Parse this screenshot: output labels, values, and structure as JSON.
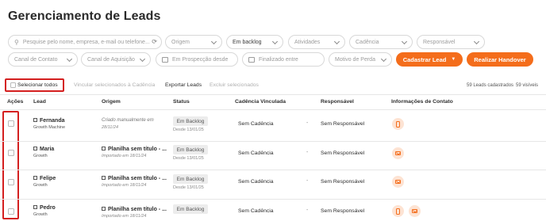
{
  "page_title": "Gerenciamento de Leads",
  "filters": {
    "search_placeholder": "Pesquise pelo nome, empresa, e-mail ou telefone...",
    "origem": "Origem",
    "status": "Em backlog",
    "atividades": "Atividades",
    "cadencia": "Cadência",
    "responsavel": "Responsável",
    "canal_contato": "Canal de Contato",
    "canal_aquisicao": "Canal de Aquisição",
    "prospeccao_desde": "Em Prospecção desde",
    "finalizado_entre": "Finalizado entre",
    "motivo_perda": "Motivo de Perda"
  },
  "actions": {
    "cadastrar_lead": "Cadastrar Lead",
    "realizar_handover": "Realizar Handover"
  },
  "toolbar": {
    "selecionar_todos": "Selecionar todos",
    "vincular": "Vincular selecionados à Cadência",
    "exportar": "Exportar Leads",
    "excluir": "Excluir selecionados",
    "cadastrados": "59 Leads cadastrados",
    "visiveis": "59 visíveis"
  },
  "columns": {
    "acoes": "Ações",
    "lead": "Lead",
    "origem": "Origem",
    "status": "Status",
    "cadencia": "Cadência Vinculada",
    "responsavel": "Responsável",
    "contato": "Informações de Contato"
  },
  "rows": [
    {
      "name": "Fernanda",
      "company": "Growth Machine",
      "origin": "Criado manualmente em",
      "origin_date": "28/11/24",
      "status": "Em Backlog",
      "status_since": "Desde 13/01/25",
      "cadence": "Sem Cadência",
      "dash": "-",
      "responsible": "Sem Responsável",
      "contact_icons": [
        "phone-icon"
      ]
    },
    {
      "name": "Maria",
      "company": "Growth",
      "origin": "Planilha sem título - ...",
      "origin_date": "Importado em 18/11/24",
      "status": "Em Backlog",
      "status_since": "Desde 13/01/25",
      "cadence": "Sem Cadência",
      "dash": "-",
      "responsible": "Sem Responsável",
      "contact_icons": [
        "mail-icon"
      ]
    },
    {
      "name": "Felipe",
      "company": "Growth",
      "origin": "Planilha sem título - ...",
      "origin_date": "Importado em 18/11/24",
      "status": "Em Backlog",
      "status_since": "Desde 13/01/25",
      "cadence": "Sem Cadência",
      "dash": "-",
      "responsible": "Sem Responsável",
      "contact_icons": [
        "mail-icon"
      ]
    },
    {
      "name": "Pedro",
      "company": "Growth",
      "origin": "Planilha sem título - ...",
      "origin_date": "Importado em 18/11/24",
      "status": "Em Backlog",
      "status_since": "",
      "cadence": "Sem Cadência",
      "dash": "-",
      "responsible": "Sem Responsável",
      "contact_icons": [
        "phone-icon",
        "mail-icon"
      ]
    }
  ],
  "colors": {
    "accent": "#f46d1b",
    "highlight_box": "#d41f1f"
  }
}
